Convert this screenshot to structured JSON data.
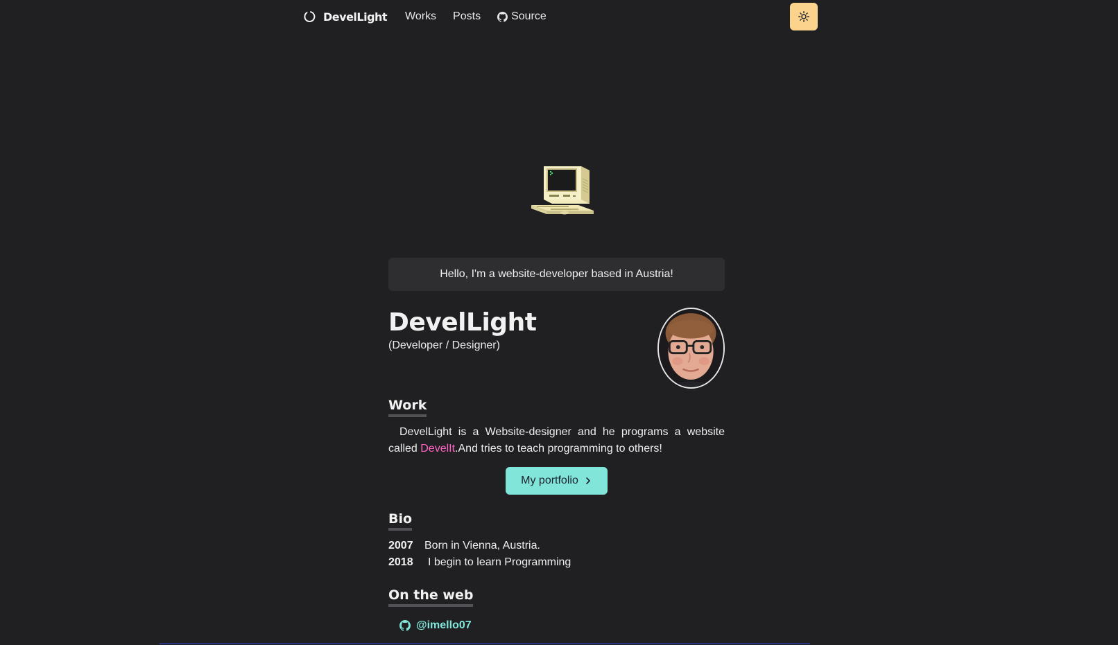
{
  "navbar": {
    "brand": "DevelLight",
    "links": [
      {
        "label": "Works"
      },
      {
        "label": "Posts"
      },
      {
        "label": "Source",
        "icon": "github-icon"
      }
    ],
    "theme_toggle_icon": "sun-icon",
    "theme_toggle_color": "#fbd38d"
  },
  "hero": {
    "illustration": "retro-computer-icon"
  },
  "hello": "Hello, I'm a website-developer based in Austria!",
  "profile": {
    "name": "DevelLight",
    "role": "(Developer / Designer)"
  },
  "work": {
    "title": "Work",
    "text_before": "DevelLight is a Website-designer and he programs a website called ",
    "link": "DevelIt",
    "text_after": ".And tries to teach programming to others!",
    "button": "My portfolio",
    "link_color": "#ff63c3",
    "button_color": "#81e6d9"
  },
  "bio": {
    "title": "Bio",
    "items": [
      {
        "year": "2007",
        "text": "Born in Vienna, Austria."
      },
      {
        "year": "2018",
        "text": "I begin to learn Programming"
      }
    ]
  },
  "web": {
    "title": "On the web",
    "links": [
      {
        "label": "@imello07",
        "icon": "github-icon"
      }
    ]
  }
}
